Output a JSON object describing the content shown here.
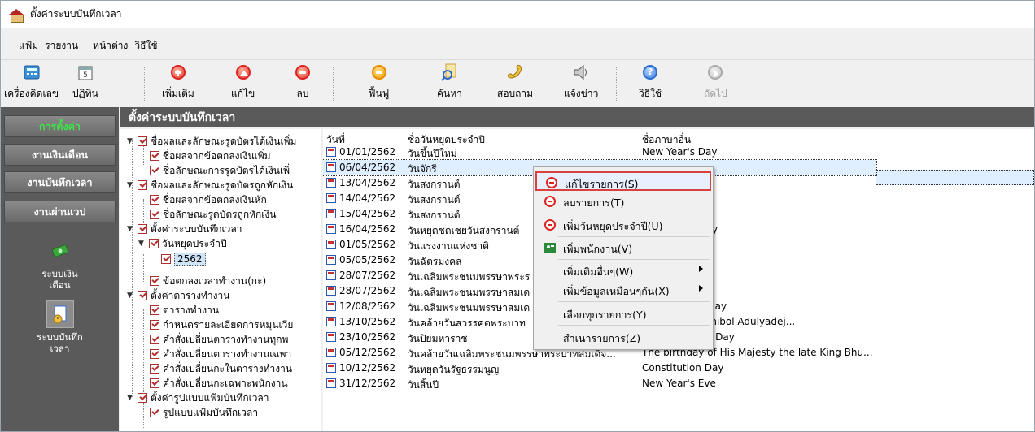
{
  "window": {
    "title": "ตั้งค่าระบบบันทึกเวลา"
  },
  "menu": {
    "items": [
      {
        "label": "แฟ้ม",
        "underline": ""
      },
      {
        "label": "รายงาน",
        "underline": "ร"
      },
      {
        "label": "หน้าต่าง",
        "underline": ""
      },
      {
        "label": "วิธีใช้",
        "underline": ""
      }
    ]
  },
  "toolbar": {
    "calculator": "เครื่องคิดเลข",
    "calendar": "ปฏิทิน",
    "add": "เพิ่มเติม",
    "edit": "แก้ไข",
    "delete": "ลบ",
    "restore": "ฟื้นฟู",
    "search": "ค้นหา",
    "inquire": "สอบถาม",
    "announce": "แจ้งข่าว",
    "help": "วิธีใช้",
    "next": "ถัดไป"
  },
  "leftnav": {
    "buttons": [
      "การตั้งค่า",
      "งานเงินเดือน",
      "งานบันทึกเวลา",
      "งานผ่านเวป"
    ],
    "icons": [
      {
        "label1": "ระบบเงิน",
        "label2": "เดือน"
      },
      {
        "label1": "ระบบบันทึก",
        "label2": "เวลา"
      }
    ]
  },
  "header": {
    "title": "ตั้งค่าระบบบันทึกเวลา"
  },
  "tree": {
    "nodes": [
      "ชื่อผลและลักษณะรูดบัตรได้เงินเพิ่ม",
      "ชื่อผลจากข้อตกลงเงินเพิ่ม",
      "ชื่อลักษณะการรูดบัตรได้เงินเพิ่",
      "ชื่อผลและลักษณะรูดบัตรถูกหักเงิน",
      "ชื่อผลจากข้อตกลงเงินหัก",
      "ชื่อลักษณะรูดบัตรถูกหักเงิน",
      "ตั้งค่าระบบบันทึกเวลา",
      "วันหยุดประจำปี",
      "2562",
      "ข้อตกลงเวลาทำงาน(กะ)",
      "ตั้งค่าตารางทำงาน",
      "ตารางทำงาน",
      "กำหนดรายละเอียดการหมุนเวีย",
      "คำสั่งเปลี่ยนตารางทำงานทุกพ",
      "คำสั่งเปลี่ยนตารางทำงานเฉพา",
      "คำสั่งเปลี่ยนกะในตารางทำงาน",
      "คำสั่งเปลี่ยนกะเฉพาะพนักงาน",
      "ตั้งค่ารูปแบบแฟ้มบันทึกเวลา",
      "รูปแบบแฟ้มบันทึกเวลา"
    ]
  },
  "grid": {
    "columns": [
      "วันที่",
      "ชื่อวันหยุดประจำปี",
      "ชื่อภาษาอื่น"
    ],
    "rows": [
      {
        "date": "01/01/2562",
        "name": "วันขึ้นปีใหม่",
        "other": "New Year's Day"
      },
      {
        "date": "06/04/2562",
        "name": "วันจักรี",
        "other": ""
      },
      {
        "date": "13/04/2562",
        "name": "วันสงกรานต์",
        "other": ""
      },
      {
        "date": "14/04/2562",
        "name": "วันสงกรานต์",
        "other": ""
      },
      {
        "date": "15/04/2562",
        "name": "วันสงกรานต์",
        "other": ""
      },
      {
        "date": "16/04/2562",
        "name": "วันหยุดชดเชยวันสงกรานต์",
        "other": "r Songkran Day"
      },
      {
        "date": "01/05/2562",
        "name": "วันแรงงานแห่งชาติ",
        "other": "r Day"
      },
      {
        "date": "05/05/2562",
        "name": "วันฉัตรมงคล",
        "other": "y"
      },
      {
        "date": "28/07/2562",
        "name": "วันเฉลิมพระชนมพรรษาพระร",
        "other": "Brithday"
      },
      {
        "date": "28/07/2562",
        "name": "วันเฉลิมพระชนมพรรษาสมเด",
        "other": "n'Brithday"
      },
      {
        "date": "12/08/2562",
        "name": "วันเฉลิมพระชนมพรรษาสมเด",
        "other": "Monther'Brithday"
      },
      {
        "date": "13/10/2562",
        "name": "วันคล้ายวันสวรรคตพระบาท",
        "other": "late King Bhumibol Adulyadej..."
      },
      {
        "date": "23/10/2562",
        "name": "วันปิยมหาราช",
        "other": "Chulalongkorn Day"
      },
      {
        "date": "05/12/2562",
        "name": "วันคล้ายวันเฉลิมพระชนมพรรษาพระบาทสมเด็จ...",
        "other": "The birthday of His Majesty the late King Bhu..."
      },
      {
        "date": "10/12/2562",
        "name": "วันหยุดวันรัฐธรรมนูญ",
        "other": "Constitution Day"
      },
      {
        "date": "31/12/2562",
        "name": "วันสิ้นปี",
        "other": "New Year's Eve"
      }
    ]
  },
  "context_menu": {
    "items": [
      "แก้ไขรายการ(S)",
      "ลบรายการ(T)",
      "เพิ่มวันหยุดประจำปี(U)",
      "เพิ่มพนักงาน(V)",
      "เพิ่มเติมอื่นๆ(W)",
      "เพิ่มข้อมูลเหมือนๆกัน(X)",
      "เลือกทุกรายการ(Y)",
      "สำเนารายการ(Z)"
    ]
  },
  "colors": {
    "nav_bg": "#5a5a5a",
    "active_nav": "#3fe34a",
    "highlight_border": "#d94040"
  }
}
